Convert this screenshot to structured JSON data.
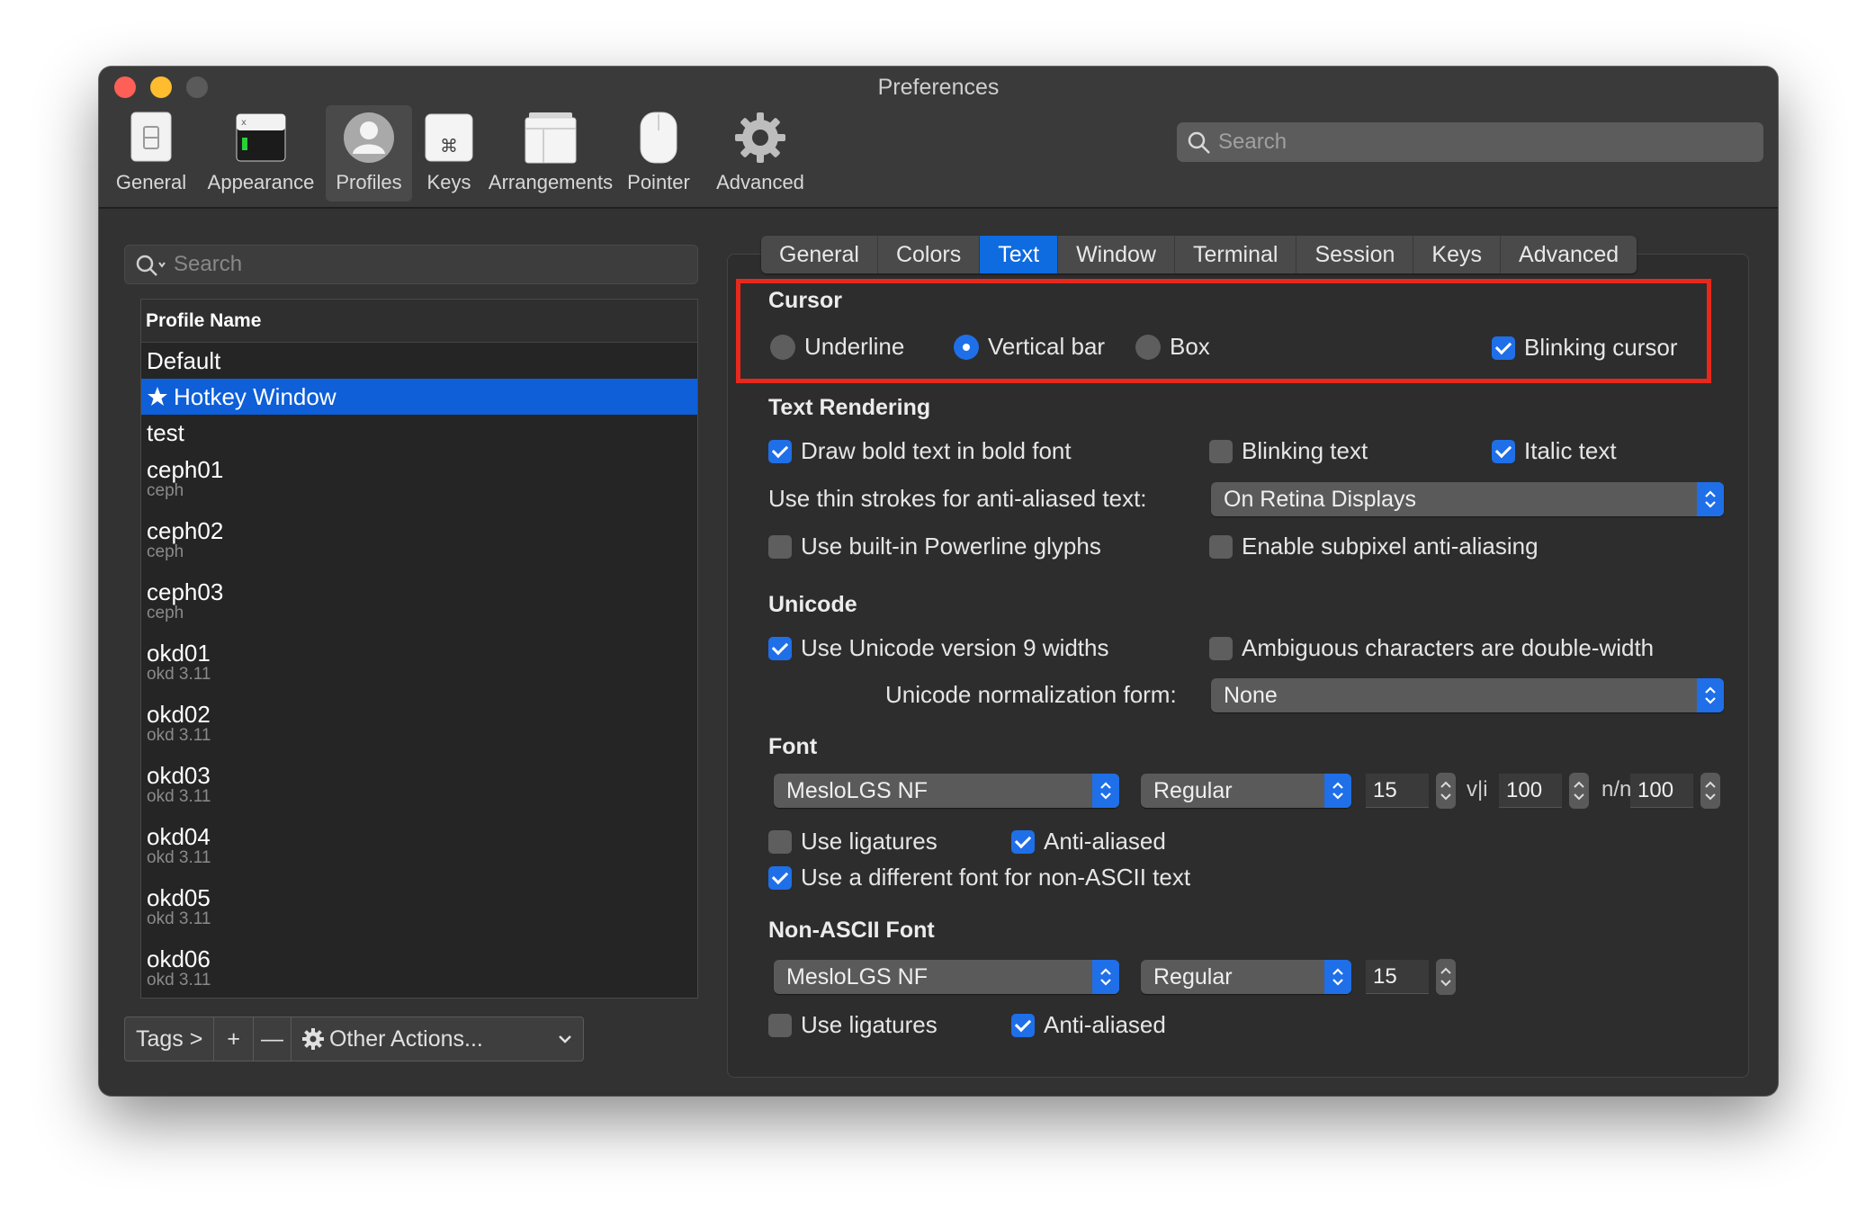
{
  "window": {
    "title": "Preferences"
  },
  "toolbar": {
    "items": [
      {
        "label": "General",
        "icon": "general-switch-icon"
      },
      {
        "label": "Appearance",
        "icon": "appearance-window-icon"
      },
      {
        "label": "Profiles",
        "icon": "profile-person-icon",
        "active": true
      },
      {
        "label": "Keys",
        "icon": "command-key-icon"
      },
      {
        "label": "Arrangements",
        "icon": "arrangement-windows-icon"
      },
      {
        "label": "Pointer",
        "icon": "mouse-icon"
      },
      {
        "label": "Advanced",
        "icon": "gear-icon"
      }
    ],
    "search_placeholder": "Search"
  },
  "profiles": {
    "search_placeholder": "Search",
    "column_header": "Profile Name",
    "items": [
      {
        "name": "Default",
        "tag": ""
      },
      {
        "name": "Hotkey Window",
        "tag": "",
        "selected": true,
        "icon": "star-icon"
      },
      {
        "name": "test",
        "tag": ""
      },
      {
        "name": "ceph01",
        "tag": "ceph"
      },
      {
        "name": "ceph02",
        "tag": "ceph"
      },
      {
        "name": "ceph03",
        "tag": "ceph"
      },
      {
        "name": "okd01",
        "tag": "okd 3.11"
      },
      {
        "name": "okd02",
        "tag": "okd 3.11"
      },
      {
        "name": "okd03",
        "tag": "okd 3.11"
      },
      {
        "name": "okd04",
        "tag": "okd 3.11"
      },
      {
        "name": "okd05",
        "tag": "okd 3.11"
      },
      {
        "name": "okd06",
        "tag": "okd 3.11"
      }
    ],
    "bottom_bar": {
      "tags": "Tags >",
      "add": "+",
      "remove": "—",
      "other_actions": "Other Actions..."
    }
  },
  "tabs": [
    "General",
    "Colors",
    "Text",
    "Window",
    "Terminal",
    "Session",
    "Keys",
    "Advanced"
  ],
  "active_tab": "Text",
  "cursor": {
    "title": "Cursor",
    "underline": "Underline",
    "vertical_bar": "Vertical bar",
    "box": "Box",
    "blinking": "Blinking cursor"
  },
  "text_rendering": {
    "title": "Text Rendering",
    "bold": "Draw bold text in bold font",
    "blinking_text": "Blinking text",
    "italic": "Italic text",
    "thin_strokes_label": "Use thin strokes for anti-aliased text:",
    "thin_strokes_value": "On Retina Displays",
    "powerline": "Use built-in Powerline glyphs",
    "subpixel": "Enable subpixel anti-aliasing"
  },
  "unicode": {
    "title": "Unicode",
    "v9_widths": "Use Unicode version 9 widths",
    "ambiguous": "Ambiguous characters are double-width",
    "normalization_label": "Unicode normalization form:",
    "normalization_value": "None"
  },
  "font": {
    "title": "Font",
    "family": "MesloLGS NF",
    "style": "Regular",
    "size": "15",
    "h_spacing": "100",
    "v_spacing": "100",
    "h_glyph": "v|i",
    "v_glyph": "n/n",
    "ligatures": "Use ligatures",
    "anti_aliased": "Anti-aliased",
    "non_ascii_toggle": "Use a different font for non-ASCII text"
  },
  "non_ascii_font": {
    "title": "Non-ASCII Font",
    "family": "MesloLGS NF",
    "style": "Regular",
    "size": "15",
    "ligatures": "Use ligatures",
    "anti_aliased": "Anti-aliased"
  },
  "colors": {
    "accent": "#1f6fe8",
    "selection": "#0e5fd8",
    "highlight_border": "#e8281c"
  }
}
